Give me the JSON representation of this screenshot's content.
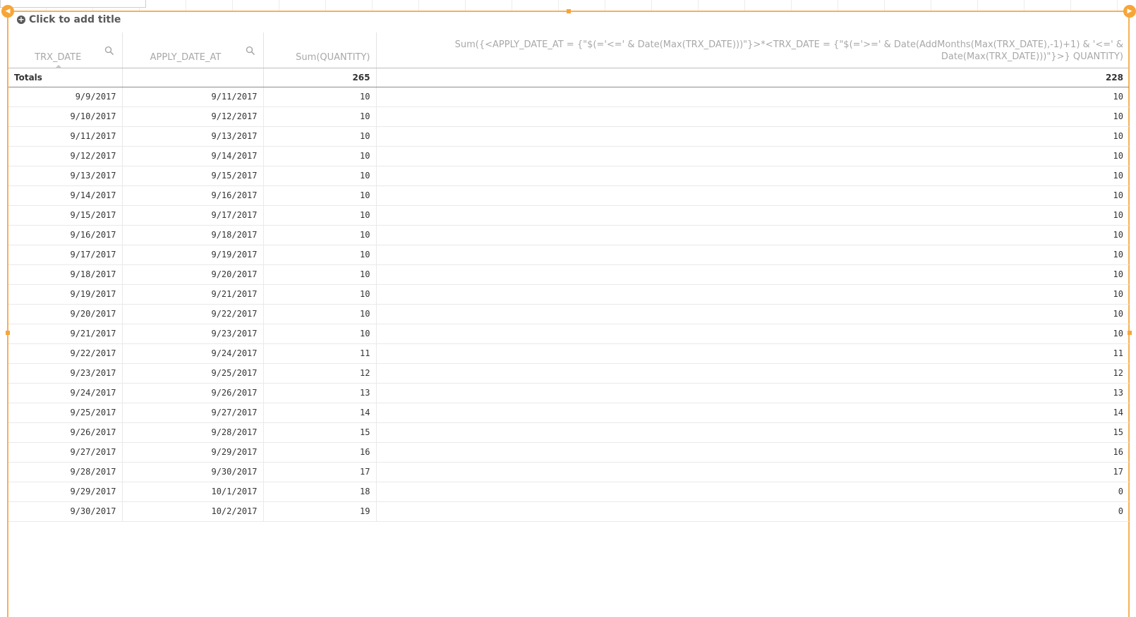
{
  "title": {
    "placeholder": "Click to add title"
  },
  "table": {
    "headers": [
      "TRX_DATE",
      "APPLY_DATE_AT",
      "Sum(QUANTITY)",
      "Sum({<APPLY_DATE_AT = {\"$(='<=' & Date(Max(TRX_DATE)))\"}>*<TRX_DATE = {\"$(='>=' & Date(AddMonths(Max(TRX_DATE),-1)+1) & '<=' & Date(Max(TRX_DATE)))\"}>} QUANTITY)"
    ],
    "totals": {
      "label": "Totals",
      "apply": "",
      "sum_quantity": "265",
      "expr": "228"
    },
    "rows": [
      [
        "9/9/2017",
        "9/11/2017",
        "10",
        "10"
      ],
      [
        "9/10/2017",
        "9/12/2017",
        "10",
        "10"
      ],
      [
        "9/11/2017",
        "9/13/2017",
        "10",
        "10"
      ],
      [
        "9/12/2017",
        "9/14/2017",
        "10",
        "10"
      ],
      [
        "9/13/2017",
        "9/15/2017",
        "10",
        "10"
      ],
      [
        "9/14/2017",
        "9/16/2017",
        "10",
        "10"
      ],
      [
        "9/15/2017",
        "9/17/2017",
        "10",
        "10"
      ],
      [
        "9/16/2017",
        "9/18/2017",
        "10",
        "10"
      ],
      [
        "9/17/2017",
        "9/19/2017",
        "10",
        "10"
      ],
      [
        "9/18/2017",
        "9/20/2017",
        "10",
        "10"
      ],
      [
        "9/19/2017",
        "9/21/2017",
        "10",
        "10"
      ],
      [
        "9/20/2017",
        "9/22/2017",
        "10",
        "10"
      ],
      [
        "9/21/2017",
        "9/23/2017",
        "10",
        "10"
      ],
      [
        "9/22/2017",
        "9/24/2017",
        "11",
        "11"
      ],
      [
        "9/23/2017",
        "9/25/2017",
        "12",
        "12"
      ],
      [
        "9/24/2017",
        "9/26/2017",
        "13",
        "13"
      ],
      [
        "9/25/2017",
        "9/27/2017",
        "14",
        "14"
      ],
      [
        "9/26/2017",
        "9/28/2017",
        "15",
        "15"
      ],
      [
        "9/27/2017",
        "9/29/2017",
        "16",
        "16"
      ],
      [
        "9/28/2017",
        "9/30/2017",
        "17",
        "17"
      ],
      [
        "9/29/2017",
        "10/1/2017",
        "18",
        "0"
      ],
      [
        "9/30/2017",
        "10/2/2017",
        "19",
        "0"
      ]
    ]
  }
}
